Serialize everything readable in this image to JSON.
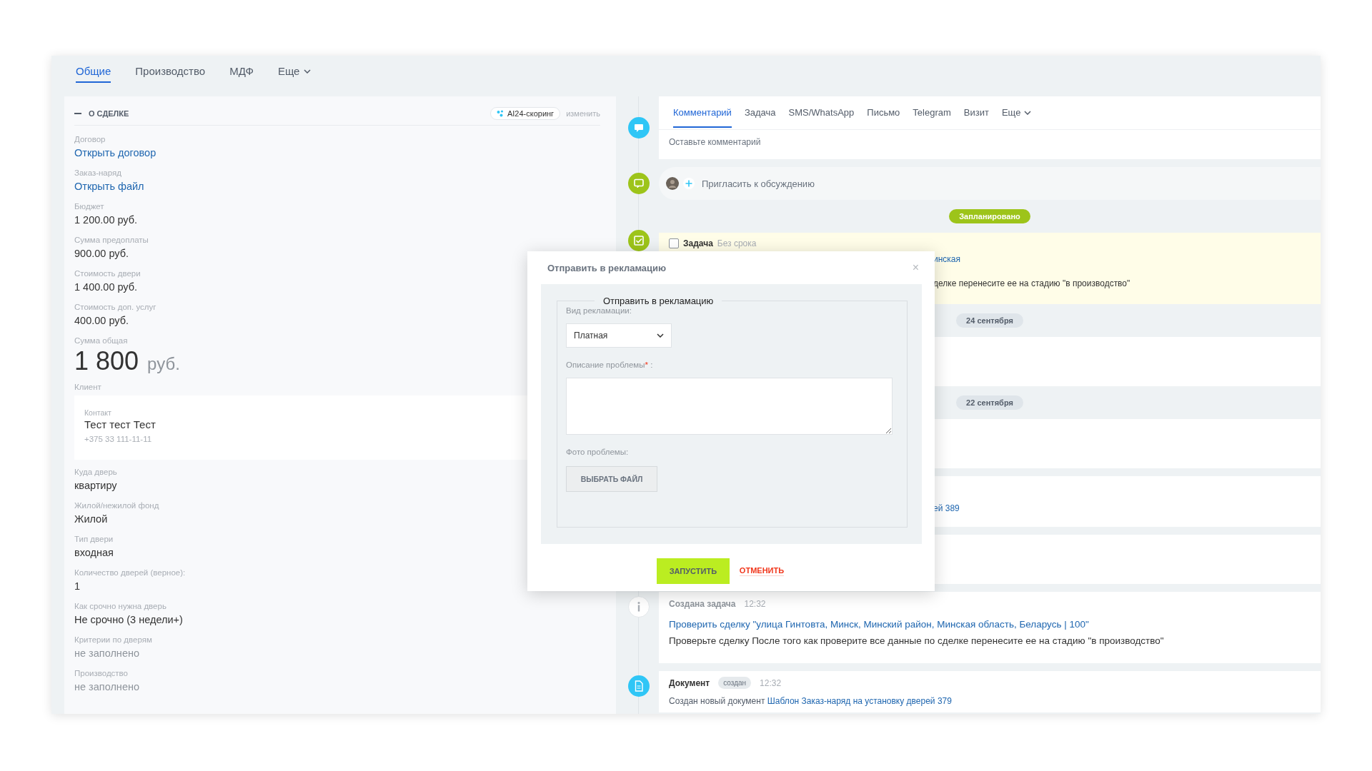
{
  "top_tabs": [
    {
      "label": "Общие",
      "selected": true,
      "dropdown": false
    },
    {
      "label": "Производство",
      "selected": false,
      "dropdown": false
    },
    {
      "label": "МДФ",
      "selected": false,
      "dropdown": false
    },
    {
      "label": "Еще",
      "selected": false,
      "dropdown": true
    }
  ],
  "deal": {
    "section_title": "О СДЕЛКЕ",
    "scoring_badge": "AI24-скоринг",
    "edit_link": "изменить",
    "fields": [
      {
        "label": "Договор",
        "value": "Открыть договор",
        "kind": "link"
      },
      {
        "label": "Заказ-наряд",
        "value": "Открыть файл",
        "kind": "link"
      },
      {
        "label": "Бюджет",
        "value": "1 200.00 руб.",
        "kind": "text"
      },
      {
        "label": "Сумма предоплаты",
        "value": "900.00 руб.",
        "kind": "text"
      },
      {
        "label": "Стоимость двери",
        "value": "1 400.00 руб.",
        "kind": "text"
      },
      {
        "label": "Стоимость доп. услуг",
        "value": "400.00 руб.",
        "kind": "text"
      },
      {
        "label": "Сумма общая",
        "value": "1 800",
        "unit": "руб.",
        "kind": "total"
      }
    ],
    "client": {
      "label": "Клиент",
      "contact_label": "Контакт",
      "name": "Тест тест Тест",
      "phone": "+375 33 111-11-11"
    },
    "more_fields": [
      {
        "label": "Куда дверь",
        "value": "квартиру",
        "kind": "text"
      },
      {
        "label": "Жилой/нежилой фонд",
        "value": "Жилой",
        "kind": "text"
      },
      {
        "label": "Тип двери",
        "value": "входная",
        "kind": "text"
      },
      {
        "label": "Количество дверей (верное):",
        "value": "1",
        "kind": "text"
      },
      {
        "label": "Как срочно нужна дверь",
        "value": "Не срочно (3 недели+)",
        "kind": "text"
      },
      {
        "label": "Критерии по дверям",
        "value": "не заполнено",
        "kind": "empty"
      },
      {
        "label": "Производство",
        "value": "не заполнено",
        "kind": "empty"
      }
    ]
  },
  "composer": {
    "tabs": [
      {
        "label": "Комментарий",
        "selected": true,
        "dropdown": false
      },
      {
        "label": "Задача",
        "selected": false,
        "dropdown": false
      },
      {
        "label": "SMS/WhatsApp",
        "selected": false,
        "dropdown": false
      },
      {
        "label": "Письмо",
        "selected": false,
        "dropdown": false
      },
      {
        "label": "Telegram",
        "selected": false,
        "dropdown": false
      },
      {
        "label": "Визит",
        "selected": false,
        "dropdown": false
      },
      {
        "label": "Еще",
        "selected": false,
        "dropdown": true
      }
    ],
    "placeholder": "Оставьте комментарий"
  },
  "invite": {
    "label": "Пригласить к обсуждению"
  },
  "timeline": [
    {
      "kind": "pill",
      "text": "Запланировано",
      "color": "#9dc41a"
    },
    {
      "kind": "task",
      "title": "Задача",
      "deadline": "Без срока",
      "checked": false,
      "link_fragment": "инская",
      "text_fragment": "делке перенесите ее на стадию \"в производство\""
    },
    {
      "kind": "pill",
      "text": "24 сентября",
      "color": "#dfe5ea"
    },
    {
      "kind": "blank"
    },
    {
      "kind": "pill",
      "text": "22 сентября",
      "color": "#dfe5ea"
    },
    {
      "kind": "blank"
    },
    {
      "kind": "fragment",
      "link_fragment": "ей 389"
    },
    {
      "kind": "blank"
    },
    {
      "kind": "created_task",
      "title": "Создана задача",
      "time": "12:32",
      "link": "Проверить сделку \"улица Гинтовта, Минск, Минский район, Минская область, Беларусь | 100\"",
      "text": "Проверьте сделку После того как проверите все данные по сделке перенесите ее на стадию \"в производство\""
    },
    {
      "kind": "document",
      "title": "Документ",
      "status": "создан",
      "time": "12:32",
      "text": "Создан новый документ",
      "link": "Шаблон Заказ-наряд на установку дверей 379"
    }
  ],
  "modal": {
    "title": "Отправить в рекламацию",
    "close": "×",
    "legend": "Отправить в рекламацию",
    "type_label": "Вид рекламации:",
    "type_value": "Платная",
    "description_label": "Описание проблемы",
    "required_mark": "*",
    "description_suffix": " :",
    "photo_label": "Фото проблемы:",
    "file_button": "ВЫБРАТЬ ФАЙЛ",
    "submit": "ЗАПУСТИТЬ",
    "cancel": "ОТМЕНИТЬ"
  }
}
